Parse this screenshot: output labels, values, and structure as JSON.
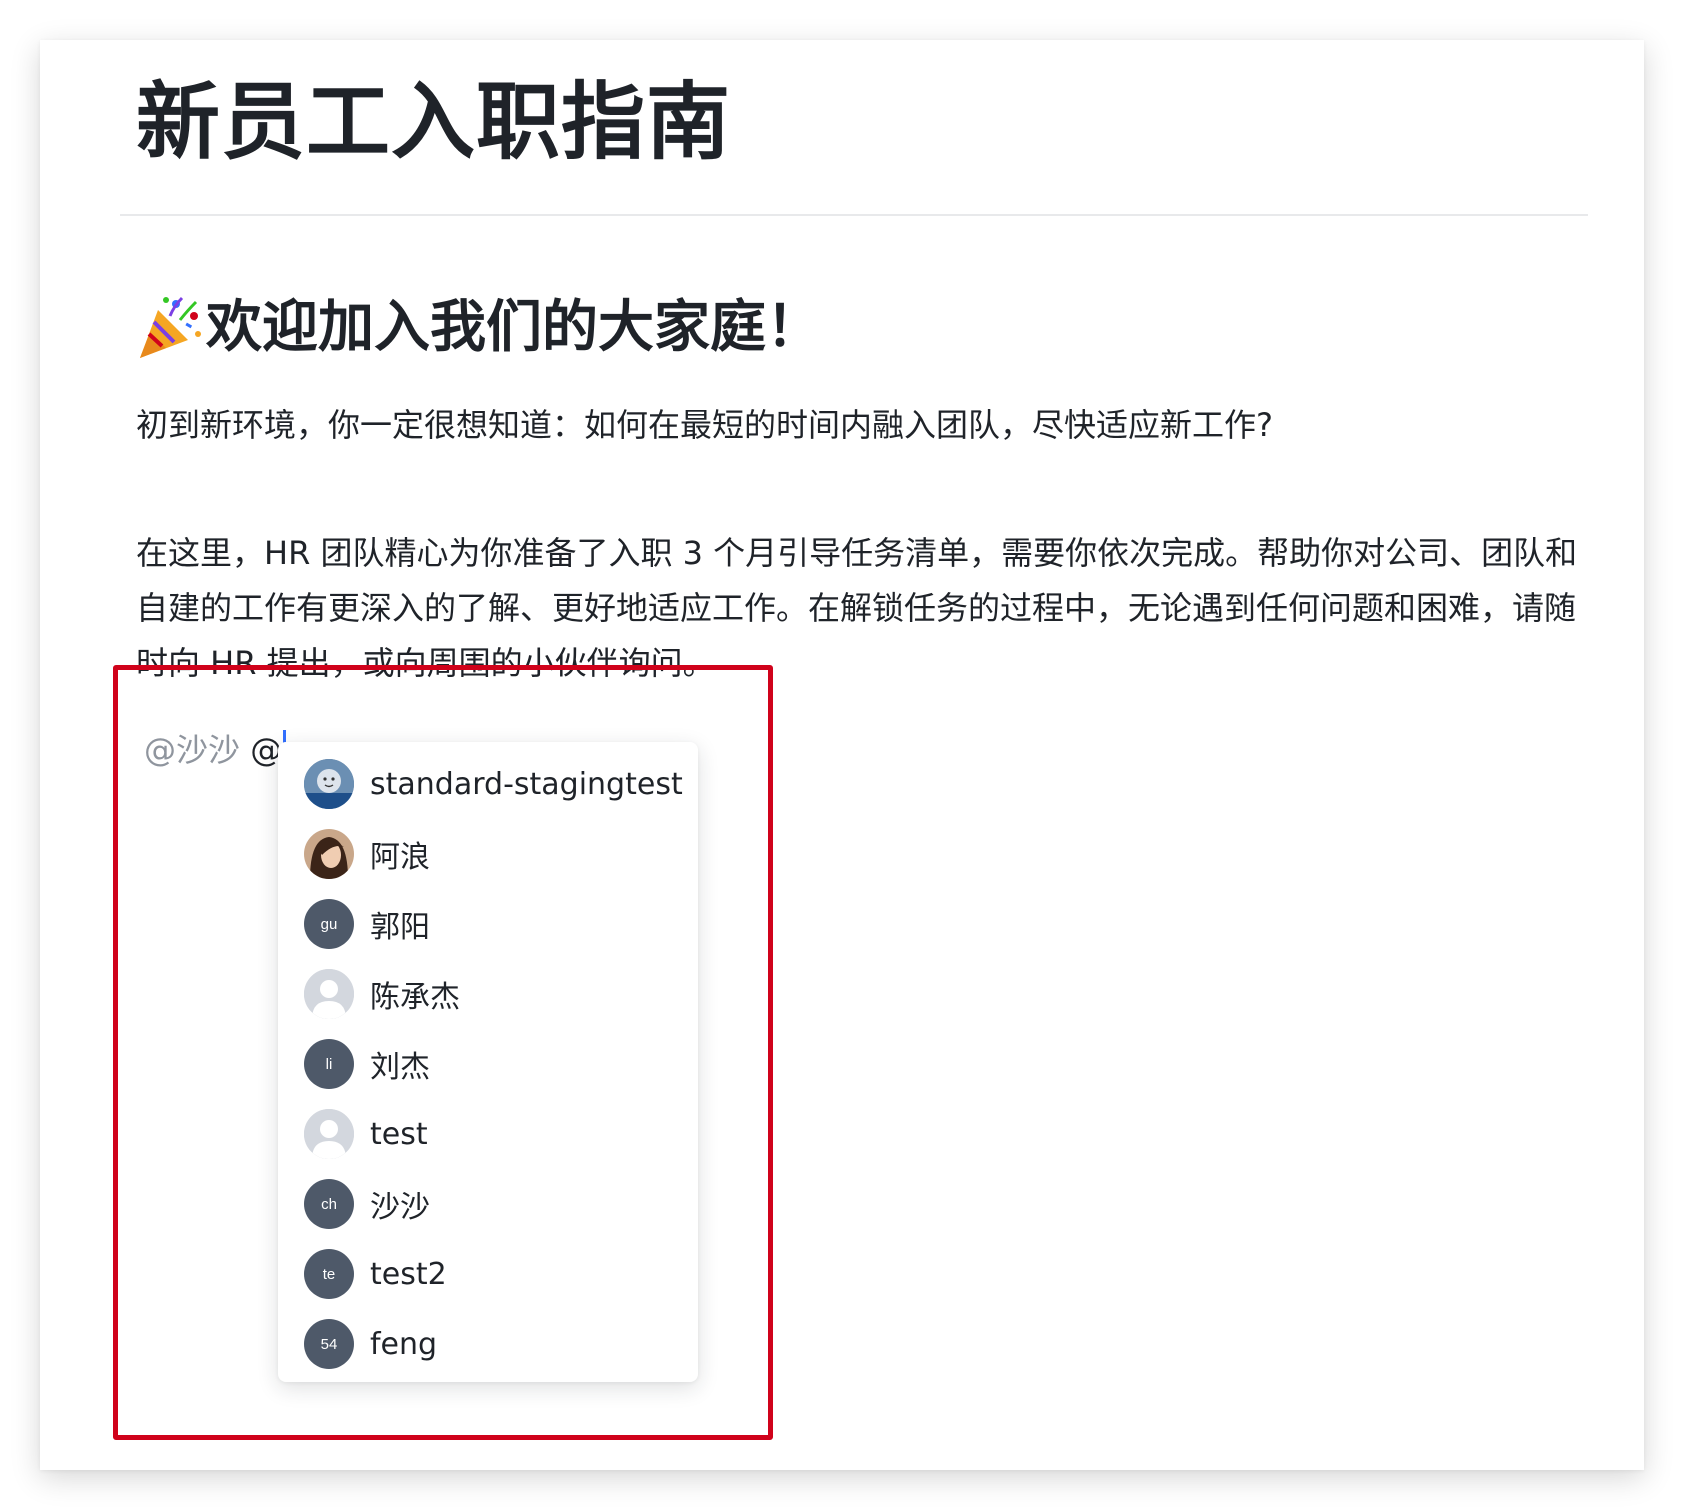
{
  "document": {
    "title": "新员工入职指南",
    "welcome_heading": "欢迎加入我们的大家庭！",
    "paragraphs": [
      "初到新环境，你一定很想知道：如何在最短的时间内融入团队，尽快适应新工作?",
      "在这里，HR 团队精心为你准备了入职 3 个月引导任务清单，需要你依次完成。帮助你对公司、团队和自建的工作有更深入的了解、更好地适应工作。在解锁任务的过程中，无论遇到任何问题和困难，请随时向 HR 提出，或向周围的小伙伴询问。"
    ]
  },
  "editor": {
    "existing_mention": "@沙沙",
    "trigger": "@"
  },
  "mention_dropdown": {
    "users": [
      {
        "name": "standard-stagingtest",
        "avatar_type": "photo-cartoon",
        "avatar_text": ""
      },
      {
        "name": "阿浪",
        "avatar_type": "photo-portrait",
        "avatar_text": ""
      },
      {
        "name": "郭阳",
        "avatar_type": "initials",
        "avatar_text": "gu"
      },
      {
        "name": "陈承杰",
        "avatar_type": "default-person",
        "avatar_text": ""
      },
      {
        "name": "刘杰",
        "avatar_type": "initials",
        "avatar_text": "li"
      },
      {
        "name": "test",
        "avatar_type": "default-person",
        "avatar_text": ""
      },
      {
        "name": "沙沙",
        "avatar_type": "initials",
        "avatar_text": "ch"
      },
      {
        "name": "test2",
        "avatar_type": "initials",
        "avatar_text": "te"
      },
      {
        "name": "feng",
        "avatar_type": "initials",
        "avatar_text": "54"
      }
    ]
  },
  "colors": {
    "highlight_border": "#d0021b",
    "caret": "#3370ff",
    "initials_avatar_bg": "#4e5969",
    "default_avatar_bg": "#d3d7de",
    "text_primary": "#1f2329",
    "text_secondary": "#8f959e"
  },
  "icons": {
    "heading_emoji": "party-popper-icon"
  }
}
